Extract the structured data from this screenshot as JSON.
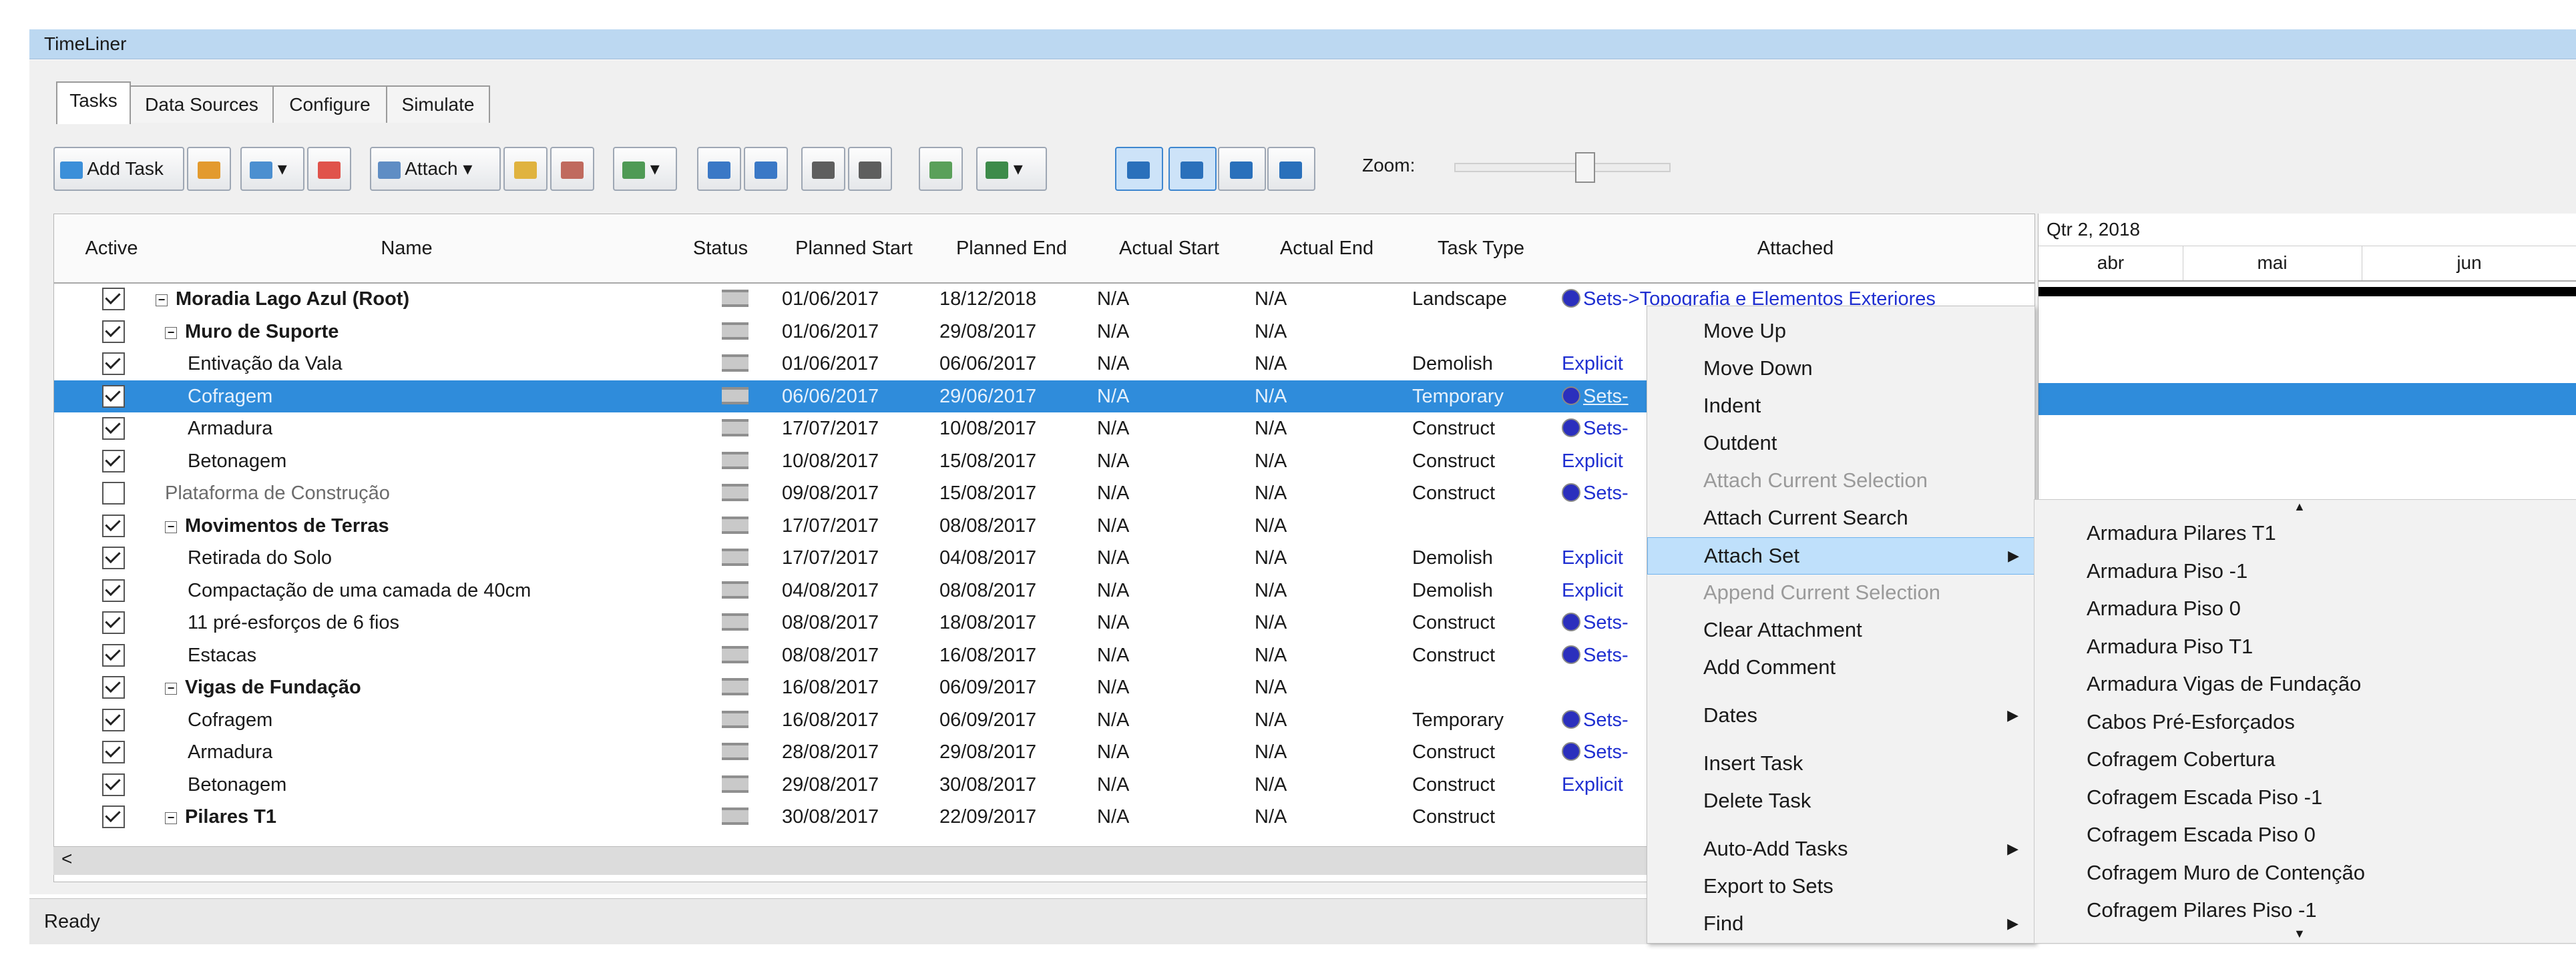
{
  "window": {
    "title": "TimeLiner"
  },
  "tabs": [
    "Tasks",
    "Data Sources",
    "Configure",
    "Simulate"
  ],
  "toolbar": {
    "add_task": "Add Task",
    "attach": "Attach",
    "zoom_label": "Zoom:",
    "zoom_level": 0.6
  },
  "columns": [
    "Active",
    "Name",
    "Status",
    "Planned Start",
    "Planned End",
    "Actual Start",
    "Actual End",
    "Task Type",
    "Attached"
  ],
  "rows": [
    {
      "active": true,
      "name": "Moradia Lago Azul (Root)",
      "bold": true,
      "collapse": true,
      "indent": 0,
      "ps": "01/06/2017",
      "pe": "18/12/2018",
      "as": "N/A",
      "ae": "N/A",
      "type": "Landscape",
      "att": "Sets->Topografia e Elementos Exteriores",
      "attType": "set"
    },
    {
      "active": true,
      "name": "Muro de Suporte",
      "bold": true,
      "collapse": true,
      "indent": 1,
      "ps": "01/06/2017",
      "pe": "29/08/2017",
      "as": "N/A",
      "ae": "N/A",
      "type": "",
      "att": "",
      "attType": ""
    },
    {
      "active": true,
      "name": "Entivação da Vala",
      "indent": 2,
      "ps": "01/06/2017",
      "pe": "06/06/2017",
      "as": "N/A",
      "ae": "N/A",
      "type": "Demolish",
      "att": "Explicit",
      "attType": "explicit"
    },
    {
      "active": true,
      "name": "Cofragem",
      "indent": 2,
      "selected": true,
      "ps": "06/06/2017",
      "pe": "29/06/2017",
      "as": "N/A",
      "ae": "N/A",
      "type": "Temporary",
      "att": "Sets-",
      "attType": "set"
    },
    {
      "active": true,
      "name": "Armadura",
      "indent": 2,
      "ps": "17/07/2017",
      "pe": "10/08/2017",
      "as": "N/A",
      "ae": "N/A",
      "type": "Construct",
      "att": "Sets-",
      "attType": "set"
    },
    {
      "active": true,
      "name": "Betonagem",
      "indent": 2,
      "ps": "10/08/2017",
      "pe": "15/08/2017",
      "as": "N/A",
      "ae": "N/A",
      "type": "Construct",
      "att": "Explicit",
      "attType": "explicit"
    },
    {
      "active": false,
      "name": "Plataforma de Construção",
      "indent": 1,
      "dim": true,
      "ps": "09/08/2017",
      "pe": "15/08/2017",
      "as": "N/A",
      "ae": "N/A",
      "type": "Construct",
      "att": "Sets-",
      "attType": "set"
    },
    {
      "active": true,
      "name": "Movimentos de Terras",
      "bold": true,
      "collapse": true,
      "indent": 1,
      "ps": "17/07/2017",
      "pe": "08/08/2017",
      "as": "N/A",
      "ae": "N/A",
      "type": "",
      "att": "",
      "attType": ""
    },
    {
      "active": true,
      "name": "Retirada do Solo",
      "indent": 2,
      "ps": "17/07/2017",
      "pe": "04/08/2017",
      "as": "N/A",
      "ae": "N/A",
      "type": "Demolish",
      "att": "Explicit",
      "attType": "explicit"
    },
    {
      "active": true,
      "name": "Compactação de uma camada de 40cm",
      "indent": 2,
      "ps": "04/08/2017",
      "pe": "08/08/2017",
      "as": "N/A",
      "ae": "N/A",
      "type": "Demolish",
      "att": "Explicit",
      "attType": "explicit"
    },
    {
      "active": true,
      "name": "11 pré-esforços de 6 fios",
      "indent": 2,
      "ps": "08/08/2017",
      "pe": "18/08/2017",
      "as": "N/A",
      "ae": "N/A",
      "type": "Construct",
      "att": "Sets-",
      "attType": "set"
    },
    {
      "active": true,
      "name": "Estacas",
      "indent": 2,
      "ps": "08/08/2017",
      "pe": "16/08/2017",
      "as": "N/A",
      "ae": "N/A",
      "type": "Construct",
      "att": "Sets-",
      "attType": "set"
    },
    {
      "active": true,
      "name": "Vigas de Fundação",
      "bold": true,
      "collapse": true,
      "indent": 1,
      "ps": "16/08/2017",
      "pe": "06/09/2017",
      "as": "N/A",
      "ae": "N/A",
      "type": "",
      "att": "",
      "attType": ""
    },
    {
      "active": true,
      "name": "Cofragem",
      "indent": 2,
      "ps": "16/08/2017",
      "pe": "06/09/2017",
      "as": "N/A",
      "ae": "N/A",
      "type": "Temporary",
      "att": "Sets-",
      "attType": "set"
    },
    {
      "active": true,
      "name": "Armadura",
      "indent": 2,
      "ps": "28/08/2017",
      "pe": "29/08/2017",
      "as": "N/A",
      "ae": "N/A",
      "type": "Construct",
      "att": "Sets-",
      "attType": "set"
    },
    {
      "active": true,
      "name": "Betonagem",
      "indent": 2,
      "ps": "29/08/2017",
      "pe": "30/08/2017",
      "as": "N/A",
      "ae": "N/A",
      "type": "Construct",
      "att": "Explicit",
      "attType": "explicit"
    },
    {
      "active": true,
      "name": "Pilares T1",
      "bold": true,
      "collapse": true,
      "indent": 1,
      "ps": "30/08/2017",
      "pe": "22/09/2017",
      "as": "N/A",
      "ae": "N/A",
      "type": "Construct",
      "att": "",
      "attType": ""
    }
  ],
  "gantt": {
    "quarter": "Qtr 2, 2018",
    "months": [
      "abr",
      "mai",
      "jun"
    ]
  },
  "context_menu": [
    {
      "label": "Move Up"
    },
    {
      "label": "Move Down"
    },
    {
      "label": "Indent"
    },
    {
      "label": "Outdent"
    },
    {
      "label": "Attach Current Selection",
      "disabled": true
    },
    {
      "label": "Attach Current Search"
    },
    {
      "label": "Attach Set",
      "submenu": true,
      "highlight": true
    },
    {
      "label": "Append Current Selection",
      "disabled": true
    },
    {
      "label": "Clear Attachment"
    },
    {
      "label": "Add Comment"
    },
    {
      "label": "Dates",
      "submenu": true,
      "gap": true
    },
    {
      "label": "Insert Task",
      "gap": true
    },
    {
      "label": "Delete Task"
    },
    {
      "label": "Auto-Add Tasks",
      "submenu": true,
      "gap": true
    },
    {
      "label": "Export to Sets"
    },
    {
      "label": "Find",
      "submenu": true
    }
  ],
  "sets_submenu": [
    "Armadura Pilares T1",
    "Armadura Piso -1",
    "Armadura Piso 0",
    "Armadura Piso T1",
    "Armadura Vigas de Fundação",
    "Cabos Pré-Esforçados",
    "Cofragem Cobertura",
    "Cofragem Escada Piso -1",
    "Cofragem Escada Piso 0",
    "Cofragem Muro de Contenção",
    "Cofragem Pilares Piso -1"
  ],
  "status_bar": {
    "text": "Ready"
  }
}
